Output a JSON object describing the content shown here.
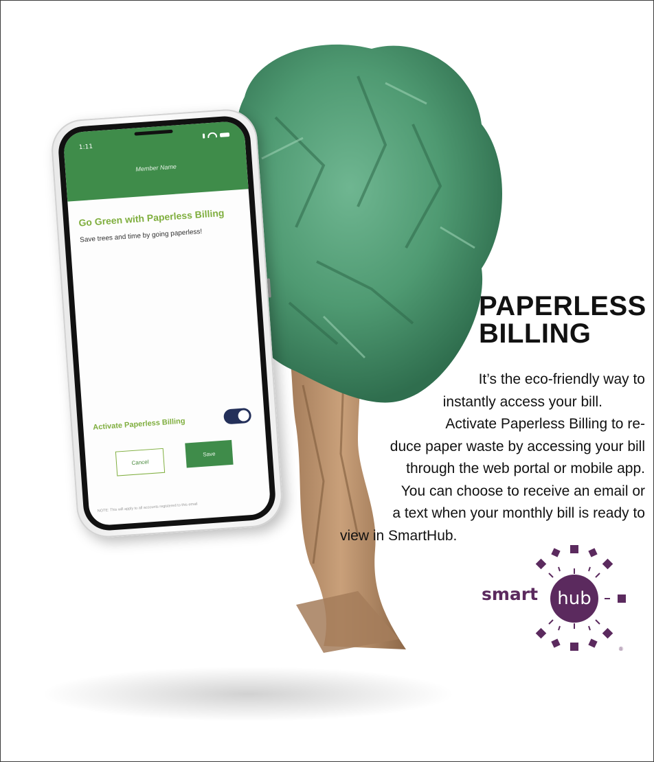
{
  "phone": {
    "status_time": "1:11",
    "header_title": "Member Name",
    "screen_title": "Go Green with Paperless Billing",
    "screen_subtitle": "Save trees and time by going paperless!",
    "toggle_label": "Activate Paperless Billing",
    "toggle_on": true,
    "cancel_label": "Cancel",
    "save_label": "Save",
    "note": "NOTE: This will apply to all accounts registered to this email"
  },
  "headline": {
    "line1": "PAPERLESS",
    "line2": "BILLING"
  },
  "body": {
    "line1": "It’s the eco-friendly way to",
    "line2": "instantly access your bill.",
    "line3": "Activate Paperless Billing to re-",
    "line4": "duce paper waste by accessing your bill",
    "line5": "through the web portal or mobile app.",
    "line6": "You can choose to receive an email or",
    "line7": "a text when your monthly bill is ready to",
    "line8": "view in SmartHub."
  },
  "logo": {
    "smart": "smart",
    "hub": "hub",
    "registered": "®"
  },
  "colors": {
    "app_green": "#3f8c4a",
    "title_green": "#7fae3e",
    "toggle_navy": "#24305a",
    "logo_purple": "#5b2a5e",
    "paper_green": "#4f9a72",
    "paper_brown": "#b58e6a"
  }
}
